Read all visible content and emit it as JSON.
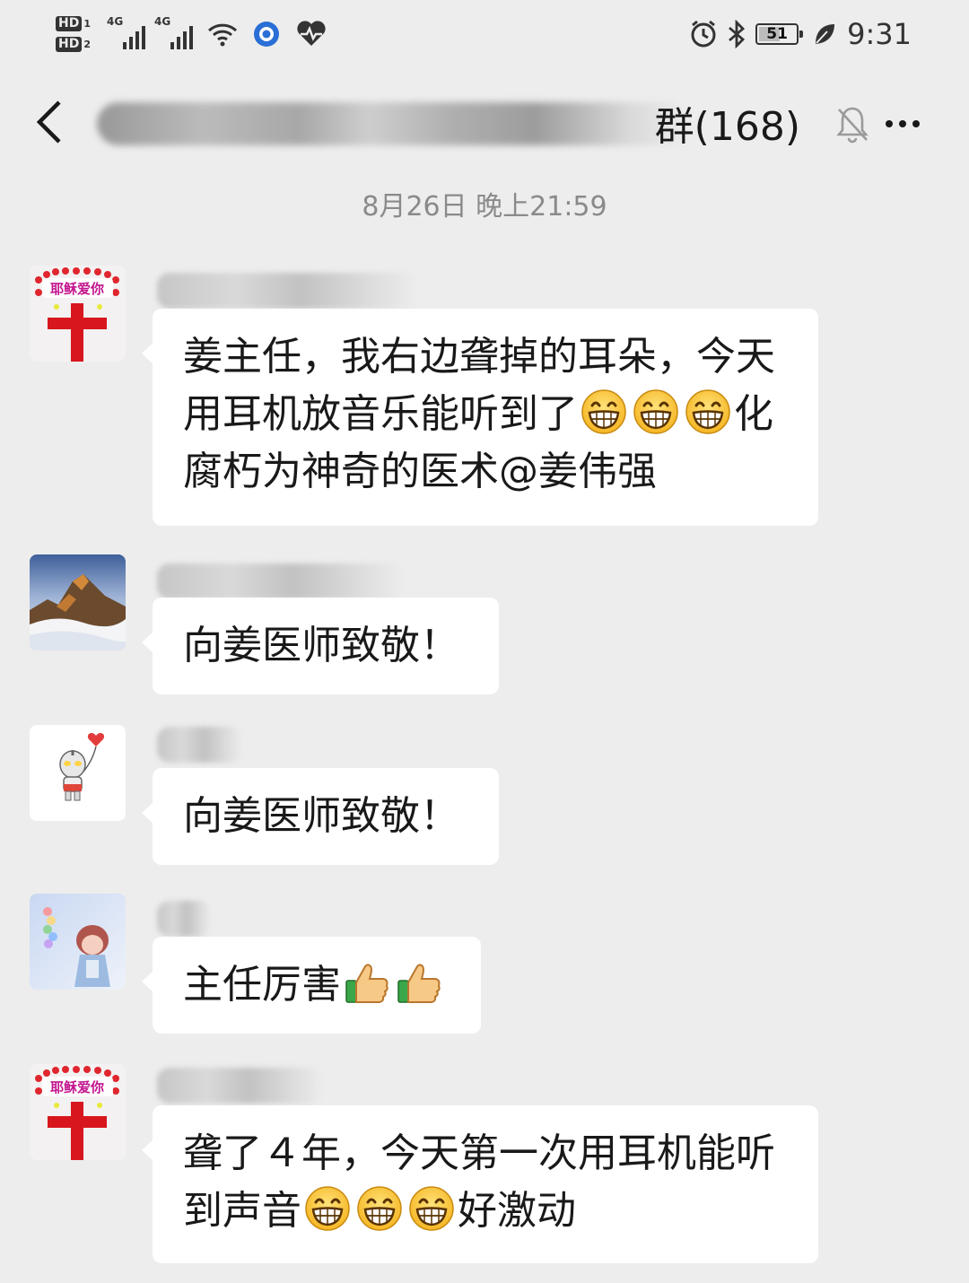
{
  "status_bar": {
    "hd1": "HD",
    "hd1_slot": "1",
    "hd2": "HD",
    "hd2_slot": "2",
    "net1": "4G",
    "net2": "4G",
    "battery": "51",
    "time": "9:31",
    "icons": [
      "signal-icon",
      "wifi-icon",
      "app-icon",
      "heart-icon",
      "alarm-icon",
      "bluetooth-icon",
      "battery-icon",
      "leaf-icon"
    ]
  },
  "header": {
    "title_visible": "群(168)",
    "back_icon": "back-chevron-icon",
    "mute_icon": "mute-bell-icon",
    "more_icon": "more-dots-icon"
  },
  "chat": {
    "timestamp": "8月26日 晚上21:59",
    "messages": [
      {
        "avatar": "cross-hearts-avatar",
        "avatar_caption": "耶稣爱你",
        "parts": [
          "姜主任，我右边聋掉的耳朵，今天用耳机放音乐能听到了",
          "化腐朽为神奇的医术@姜伟强"
        ],
        "emoji_count": 3,
        "emoji": "grin-emoji"
      },
      {
        "avatar": "mountain-avatar",
        "text": "向姜医师致敬！"
      },
      {
        "avatar": "ultraman-balloon-avatar",
        "text": "向姜医师致敬！"
      },
      {
        "avatar": "girl-avatar",
        "text": "主任厉害",
        "emoji_count": 2,
        "emoji": "thumbs-up-emoji"
      },
      {
        "avatar": "cross-hearts-avatar",
        "avatar_caption": "耶稣爱你",
        "parts": [
          "聋了４年，今天第一次用耳机能听到声音",
          "好激动"
        ],
        "emoji_count": 3,
        "emoji": "grin-emoji"
      }
    ]
  }
}
